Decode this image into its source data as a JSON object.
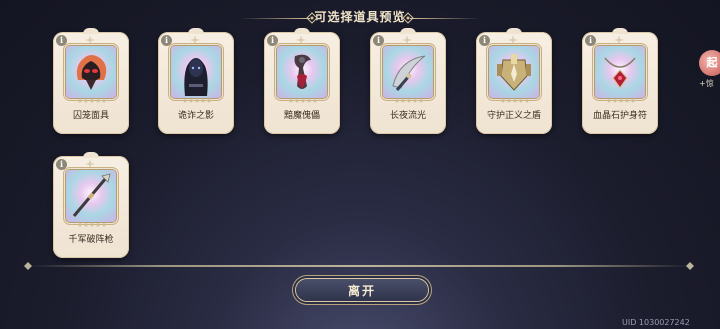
{
  "header": {
    "title": "可选择道具预览"
  },
  "items": [
    {
      "name": "囚笼面具",
      "icon": "flaming-mask-icon",
      "info": "i"
    },
    {
      "name": "诡诈之影",
      "icon": "hooded-figure-icon",
      "info": "i"
    },
    {
      "name": "黯魔傀儡",
      "icon": "dark-puppet-icon",
      "info": "i"
    },
    {
      "name": "长夜流光",
      "icon": "crescent-blade-icon",
      "info": "i"
    },
    {
      "name": "守护正义之盾",
      "icon": "golden-armor-icon",
      "info": "i"
    },
    {
      "name": "血晶石护身符",
      "icon": "amulet-icon",
      "info": "i"
    },
    {
      "name": "千军破阵枪",
      "icon": "spear-icon",
      "info": "i"
    }
  ],
  "footer": {
    "leave_label": "离开",
    "uid": "UID 1030027242"
  },
  "side_float": {
    "bubble": "起",
    "label": "+惊"
  },
  "colors": {
    "card_bg": "#f7efe3",
    "gold_accent": "#d6c59b",
    "button_bg": "#3c405a",
    "page_bg": "#1b1c2c"
  }
}
